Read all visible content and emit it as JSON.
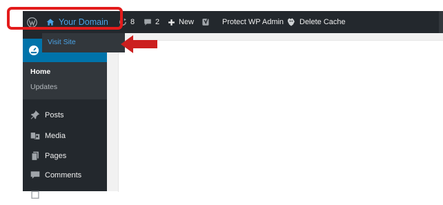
{
  "adminbar": {
    "site_name": "Your Domain",
    "updates_count": "8",
    "comments_count": "2",
    "new_label": "New",
    "protect_label": "Protect WP Admin",
    "cache_label": "Delete Cache"
  },
  "dropdown": {
    "visit_site": "Visit Site"
  },
  "sidebar": {
    "submenu": {
      "home": "Home",
      "updates": "Updates"
    },
    "items": [
      {
        "label": "Posts",
        "icon": "pin-icon"
      },
      {
        "label": "Media",
        "icon": "media-icon"
      },
      {
        "label": "Pages",
        "icon": "pages-icon"
      },
      {
        "label": "Comments",
        "icon": "comment-icon"
      }
    ]
  },
  "colors": {
    "adminbar_bg": "#23282d",
    "accent_blue": "#0073aa",
    "link_blue": "#4aa3e6",
    "annotation_red": "#e31b1b"
  }
}
